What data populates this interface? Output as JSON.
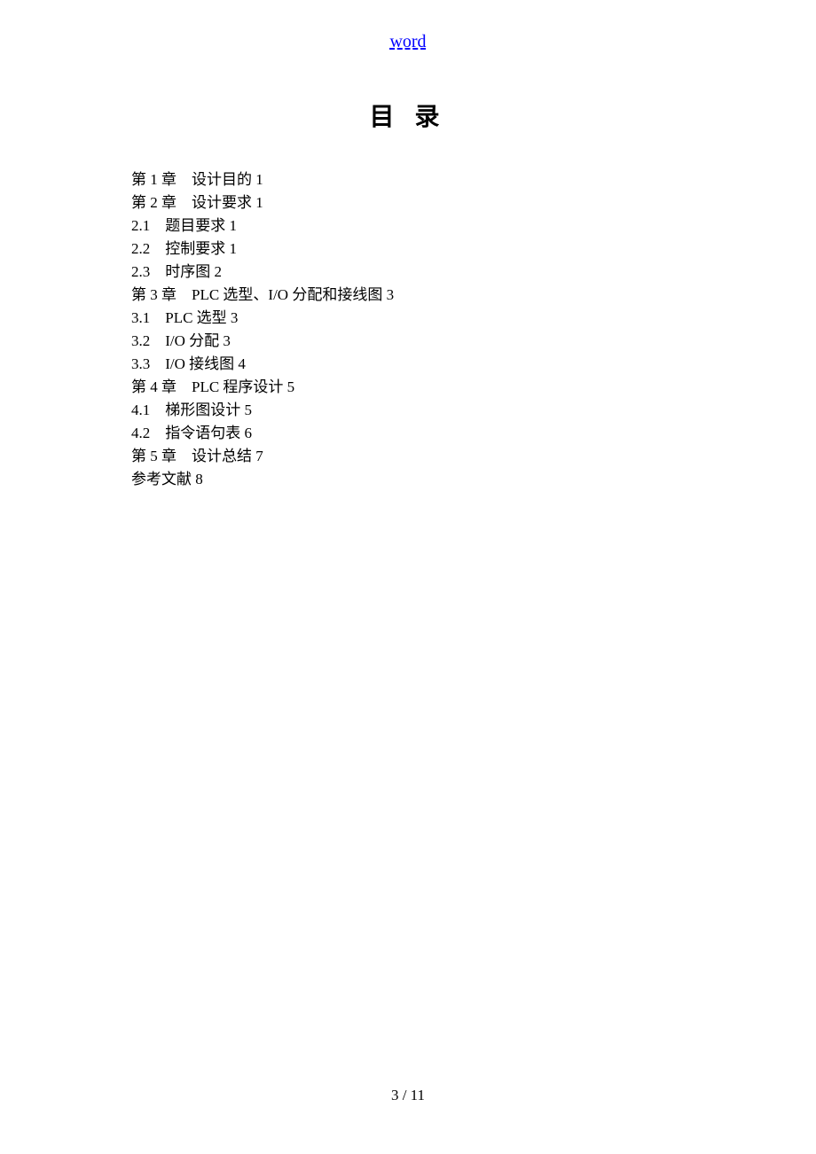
{
  "header": {
    "link_text": "word"
  },
  "title": "目 录",
  "toc": [
    {
      "text": "第 1 章　设计目的 1"
    },
    {
      "text": "第 2 章　设计要求 1"
    },
    {
      "text": "2.1　题目要求 1"
    },
    {
      "text": "2.2　控制要求 1"
    },
    {
      "text": "2.3　时序图 2"
    },
    {
      "text": "第 3 章　PLC 选型、I/O 分配和接线图 3"
    },
    {
      "text": "3.1　PLC 选型 3"
    },
    {
      "text": "3.2　I/O 分配 3"
    },
    {
      "text": "3.3　I/O 接线图 4"
    },
    {
      "text": "第 4 章　PLC 程序设计 5"
    },
    {
      "text": "4.1　梯形图设计 5"
    },
    {
      "text": "4.2　指令语句表 6"
    },
    {
      "text": "第 5 章　设计总结 7"
    },
    {
      "text": "参考文献 8"
    }
  ],
  "footer": {
    "page_indicator": "3 / 11"
  }
}
